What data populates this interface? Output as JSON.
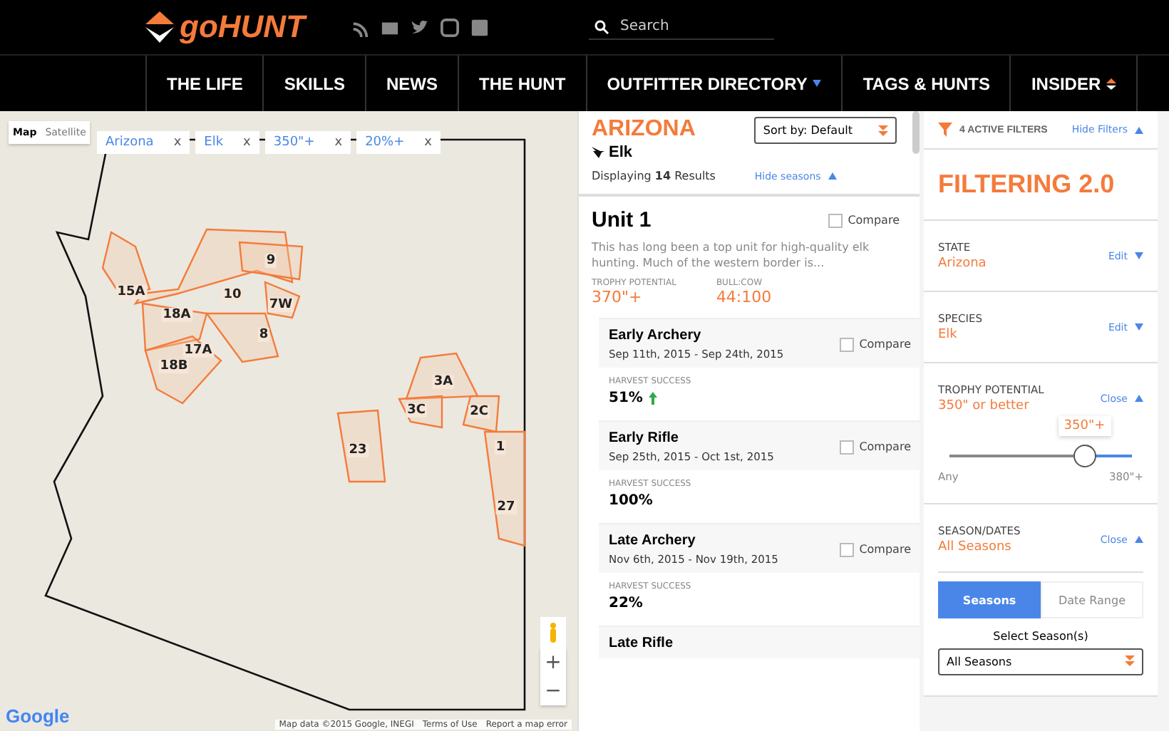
{
  "header": {
    "logo": "goHUNT",
    "search": {
      "placeholder": "Search"
    }
  },
  "nav": [
    {
      "label": "THE LIFE",
      "kind": "plain"
    },
    {
      "label": "SKILLS",
      "kind": "plain"
    },
    {
      "label": "NEWS",
      "kind": "plain"
    },
    {
      "label": "THE HUNT",
      "kind": "plain"
    },
    {
      "label": "OUTFITTER DIRECTORY",
      "kind": "dropdown"
    },
    {
      "label": "TAGS & HUNTS",
      "kind": "plain"
    },
    {
      "label": "INSIDER",
      "kind": "insider"
    }
  ],
  "map": {
    "toggle": [
      {
        "label": "Map",
        "selected": true
      },
      {
        "label": "Satellite",
        "selected": false
      }
    ],
    "chips": [
      {
        "label": "Arizona",
        "close": "x"
      },
      {
        "label": "Elk",
        "close": "x"
      },
      {
        "label": "350\"+",
        "close": "x"
      },
      {
        "label": "20%+",
        "close": "x"
      }
    ],
    "units": [
      "9",
      "10",
      "7W",
      "15A",
      "18A",
      "8",
      "17A",
      "18B",
      "3A",
      "3C",
      "2C",
      "23",
      "1",
      "27"
    ],
    "logo": "Google",
    "attribution": [
      "Map data ©2015 Google, INEGI",
      "Terms of Use",
      "Report a map error"
    ],
    "zoom": [
      "+",
      "−"
    ]
  },
  "results": {
    "state": "ARIZONA",
    "species": "Elk",
    "summary": "Displaying **14** Results",
    "sort": "Sort by: Default",
    "toggle": "Hide seasons",
    "unit": {
      "name": "Unit 1",
      "compare": {
        "label": "Compare",
        "checked": false
      },
      "description": "This has long been a top unit for high-quality elk hunting. Much of the western border is...",
      "stats": [
        {
          "label": "TROPHY POTENTIAL",
          "value": "370\"+"
        },
        {
          "label": "BULL:COW",
          "value": "44:100"
        }
      ]
    },
    "seasons": [
      {
        "name": "Early Archery",
        "dates": "Sep 11th, 2015 - Sep 24th, 2015",
        "compare": {
          "label": "Compare",
          "checked": false
        },
        "success_label": "HARVEST SUCCESS",
        "success": "51%",
        "rising": true
      },
      {
        "name": "Early Rifle",
        "dates": "Sep 25th, 2015 - Oct 1st, 2015",
        "compare": {
          "label": "Compare",
          "checked": false
        },
        "success_label": "HARVEST SUCCESS",
        "success": "100%",
        "rising": false
      },
      {
        "name": "Late Archery",
        "dates": "Nov 6th, 2015 - Nov 19th, 2015",
        "compare": {
          "label": "Compare",
          "checked": false
        },
        "success_label": "HARVEST SUCCESS",
        "success": "22%",
        "rising": false
      },
      {
        "name": "Late Rifle"
      }
    ]
  },
  "filters": {
    "active": "4 ACTIVE FILTERS",
    "toggle": "Hide Filters",
    "title": "FILTERING 2.0",
    "groups": [
      {
        "label": "STATE",
        "value": "Arizona",
        "action": "Edit",
        "expanded": false
      },
      {
        "label": "SPECIES",
        "value": "Elk",
        "action": "Edit",
        "expanded": false
      },
      {
        "label": "TROPHY POTENTIAL",
        "value": "350\" or better",
        "action": "Close",
        "expanded": true,
        "kind": "slider"
      },
      {
        "label": "SEASON/DATES",
        "value": "All Seasons",
        "action": "Close",
        "expanded": true,
        "kind": "seasons"
      }
    ],
    "slider": {
      "level": 0.74,
      "tooltip": "350\"+",
      "min": "Any",
      "max": "380\"+"
    },
    "season_tabs": [
      {
        "label": "Seasons",
        "selected": true
      },
      {
        "label": "Date Range",
        "selected": false
      }
    ],
    "select_label": "Select Season(s)",
    "select": "All Seasons"
  }
}
